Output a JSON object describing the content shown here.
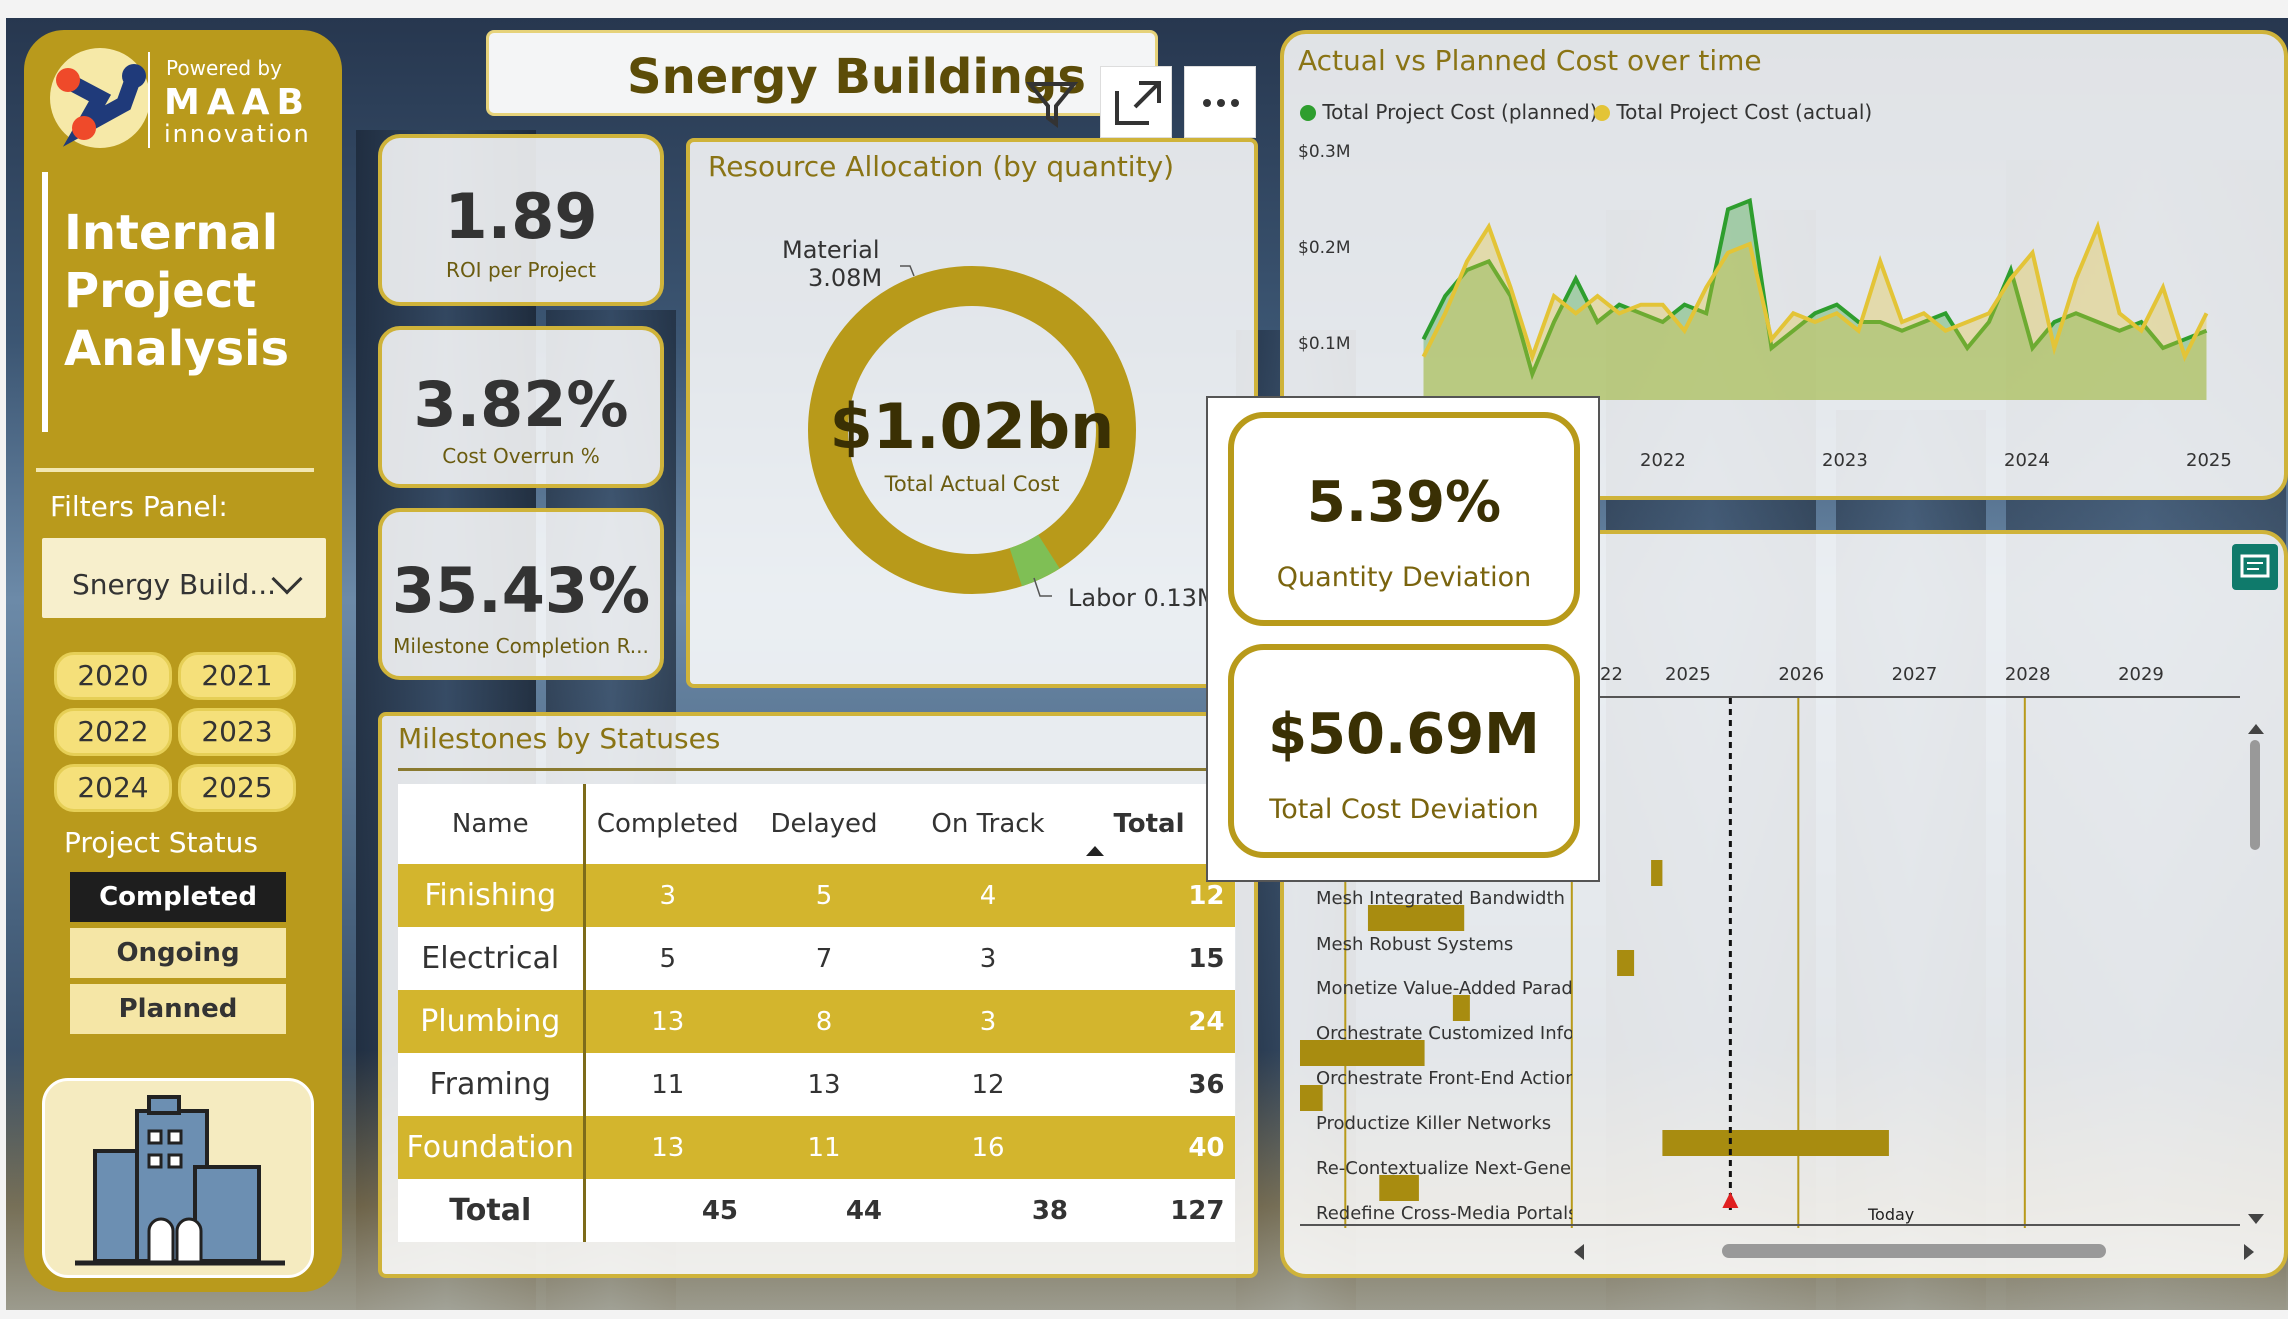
{
  "brand": {
    "powered_by": "Powered by",
    "name": "MAAB",
    "sub": "innovation"
  },
  "report_title": "Internal Project Analysis",
  "header_title": "Snergy Buildings",
  "filters": {
    "label": "Filters Panel:",
    "dropdown_value": "Snergy Build...",
    "years": [
      "2020",
      "2021",
      "2022",
      "2023",
      "2024",
      "2025"
    ],
    "status_label": "Project Status",
    "statuses": [
      "Completed",
      "Ongoing",
      "Planned"
    ],
    "selected_status": "Completed"
  },
  "kpis": {
    "roi": {
      "value": "1.89",
      "label": "ROI per Project"
    },
    "overrun": {
      "value": "3.82%",
      "label": "Cost Overrun %"
    },
    "milestone": {
      "value": "35.43%",
      "label": "Milestone Completion R..."
    }
  },
  "resource": {
    "title": "Resource Allocation (by quantity)",
    "center_value": "$1.02bn",
    "center_label": "Total Actual Cost",
    "material_label": "Material",
    "material_value": "3.08M",
    "labor_label": "Labor 0.13M",
    "chart_data": {
      "type": "pie",
      "categories": [
        "Material",
        "Labor"
      ],
      "values": [
        3.08,
        0.13
      ],
      "unit": "M"
    }
  },
  "milestones": {
    "title": "Milestones by Statuses",
    "columns": [
      "Name",
      "Completed",
      "Delayed",
      "On Track",
      "Total"
    ],
    "rows": [
      {
        "name": "Finishing",
        "completed": "3",
        "delayed": "5",
        "on_track": "4",
        "total": "12"
      },
      {
        "name": "Electrical",
        "completed": "5",
        "delayed": "7",
        "on_track": "3",
        "total": "15"
      },
      {
        "name": "Plumbing",
        "completed": "13",
        "delayed": "8",
        "on_track": "3",
        "total": "24"
      },
      {
        "name": "Framing",
        "completed": "11",
        "delayed": "13",
        "on_track": "12",
        "total": "36"
      },
      {
        "name": "Foundation",
        "completed": "13",
        "delayed": "11",
        "on_track": "16",
        "total": "40"
      }
    ],
    "total": {
      "name": "Total",
      "completed": "45",
      "delayed": "44",
      "on_track": "38",
      "total": "127"
    }
  },
  "cost_chart": {
    "title": "Actual vs Planned Cost over time",
    "legend": [
      "Total Project Cost (planned)",
      "Total Project Cost (actual)"
    ],
    "colors": {
      "planned": "#2e9e2e",
      "actual": "#e3c437"
    },
    "y_ticks": [
      "$0.3M",
      "$0.2M",
      "$0.1M"
    ],
    "x_ticks": [
      "2022",
      "2023",
      "2024",
      "2025"
    ],
    "chart_data": {
      "type": "area",
      "ylim": [
        0,
        0.3
      ],
      "x": [
        2021.5,
        2021.6,
        2021.7,
        2021.8,
        2021.9,
        2022.0,
        2022.1,
        2022.2,
        2022.3,
        2022.4,
        2022.5,
        2022.6,
        2022.7,
        2022.8,
        2022.9,
        2023.0,
        2023.1,
        2023.2,
        2023.3,
        2023.4,
        2023.5,
        2023.6,
        2023.7,
        2023.8,
        2023.9,
        2024.0,
        2024.1,
        2024.2,
        2024.3,
        2024.4,
        2024.5,
        2024.6,
        2024.7,
        2024.8,
        2024.9,
        2025.0,
        2025.1
      ],
      "series": [
        {
          "name": "Total Project Cost (planned)",
          "values": [
            0.07,
            0.12,
            0.15,
            0.16,
            0.12,
            0.03,
            0.09,
            0.14,
            0.09,
            0.11,
            0.1,
            0.09,
            0.11,
            0.1,
            0.22,
            0.23,
            0.06,
            0.08,
            0.1,
            0.11,
            0.09,
            0.09,
            0.08,
            0.09,
            0.1,
            0.06,
            0.09,
            0.15,
            0.06,
            0.09,
            0.1,
            0.09,
            0.08,
            0.09,
            0.06,
            0.07,
            0.08
          ]
        },
        {
          "name": "Total Project Cost (actual)",
          "values": [
            0.05,
            0.1,
            0.16,
            0.2,
            0.13,
            0.05,
            0.12,
            0.1,
            0.12,
            0.1,
            0.11,
            0.11,
            0.08,
            0.13,
            0.17,
            0.18,
            0.07,
            0.1,
            0.09,
            0.1,
            0.08,
            0.16,
            0.09,
            0.1,
            0.08,
            0.09,
            0.1,
            0.14,
            0.17,
            0.06,
            0.14,
            0.2,
            0.1,
            0.08,
            0.13,
            0.05,
            0.1
          ]
        }
      ]
    }
  },
  "popup": {
    "qty_dev": {
      "value": "5.39%",
      "label": "Quantity Deviation"
    },
    "cost_dev": {
      "value": "$50.69M",
      "label": "Total Cost Deviation"
    }
  },
  "gantt": {
    "years": [
      "2022",
      "2023",
      "2024",
      "2025",
      "2026",
      "2027",
      "2028",
      "2029"
    ],
    "year_first_label": "22",
    "today_label": "Today",
    "chart_data": {
      "type": "bar",
      "categories": [
        "Mesh Integrated Bandwidth",
        "Mesh Robust Systems",
        "Monetize Value-Added Paradigr",
        "Orchestrate Customized Info-M",
        "Orchestrate Front-End Action-It",
        "Productize Killer Networks",
        "Re-Contextualize Next-Generat",
        "Redefine Cross-Media Portals"
      ],
      "start": [
        2024.7,
        2022.2,
        2024.4,
        2022.95,
        2021.6,
        2021.6,
        2024.8,
        2022.3
      ],
      "end": [
        2024.8,
        2023.05,
        2024.55,
        2023.1,
        2022.7,
        2021.8,
        2026.8,
        2022.65
      ],
      "unlabeled_bars": [
        {
          "start": 2022.2,
          "end": 2022.35
        },
        {
          "start": 2022.0,
          "end": 2022.1
        }
      ],
      "today": 2025.4
    }
  }
}
